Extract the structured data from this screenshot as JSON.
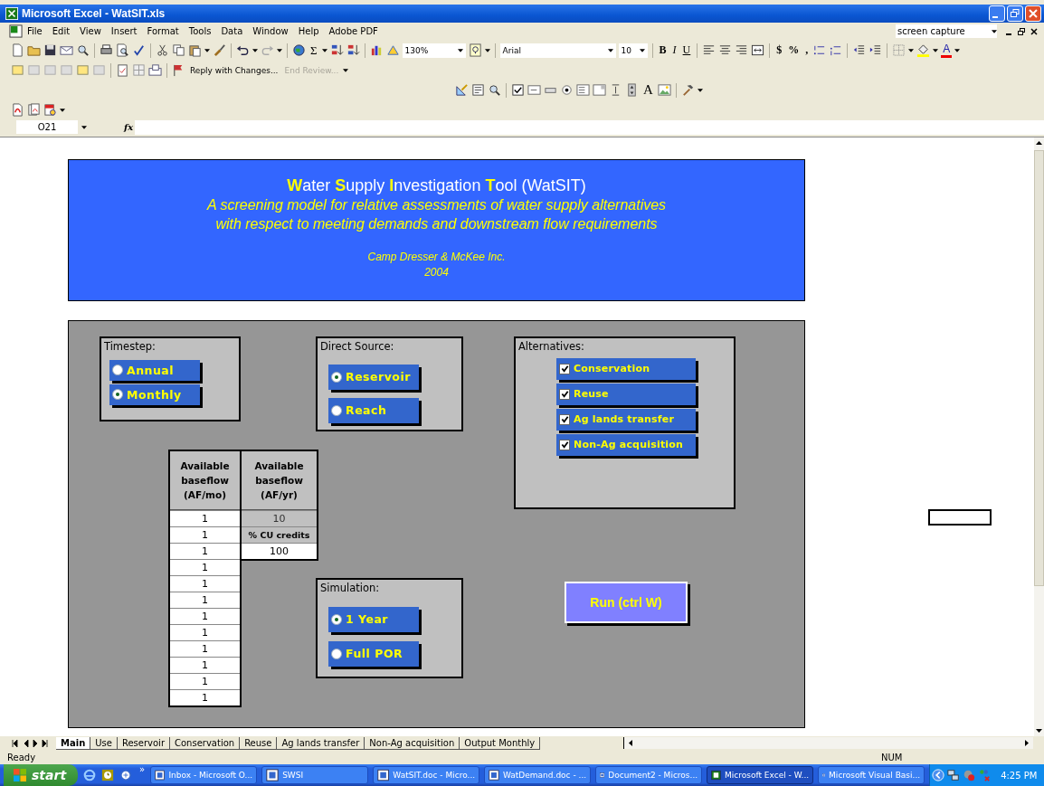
{
  "window": {
    "title": "Microsoft Excel - WatSIT.xls"
  },
  "menu": [
    "File",
    "Edit",
    "View",
    "Insert",
    "Format",
    "Tools",
    "Data",
    "Window",
    "Help",
    "Adobe PDF"
  ],
  "help_box": {
    "value": "screen capture"
  },
  "toolbar": {
    "sum": "Σ",
    "zoom": "130%",
    "font": "Arial",
    "font_size": "10",
    "format_buttons": [
      "B",
      "I",
      "U"
    ],
    "number_buttons": [
      "$",
      "%",
      ","
    ],
    "font_color": "A"
  },
  "review_toolbar": {
    "reply": "Reply with Changes...",
    "end_review": "End Review...",
    "end_review_disabled": true
  },
  "forms_toolbar": {
    "label_tool": "A"
  },
  "formula_bar": {
    "name_box": "O21",
    "fx": "fx"
  },
  "banner": {
    "title": "**W**ater **S**upply **I**nvestigation **T**ool (WatSIT)",
    "subtitle": [
      "A screening model for relative assessments of water supply alternatives",
      "with respect to meeting demands and downstream flow requirements"
    ],
    "author": "Camp Dresser & McKee Inc.",
    "year": "2004"
  },
  "timestep": {
    "label": "Timestep:",
    "options": [
      {
        "label": "Annual",
        "selected": false
      },
      {
        "label": "Monthly",
        "selected": true
      }
    ]
  },
  "direct_source": {
    "label": "Direct Source:",
    "options": [
      {
        "label": "Reservoir",
        "selected": true
      },
      {
        "label": "Reach",
        "selected": false
      }
    ]
  },
  "alternatives": {
    "label": "Alternatives:",
    "items": [
      {
        "label": "Conservation",
        "checked": true
      },
      {
        "label": "Reuse",
        "checked": true
      },
      {
        "label": "Ag lands transfer",
        "checked": true
      },
      {
        "label": "Non-Ag acquisition",
        "checked": true
      }
    ]
  },
  "baseflow_table": {
    "columns": [
      "Available baseflow (AF/mo)",
      "Available baseflow (AF/yr)"
    ],
    "monthly": [
      "1",
      "1",
      "1",
      "1",
      "1",
      "1",
      "1",
      "1",
      "1",
      "1",
      "1",
      "1"
    ],
    "annual": [
      {
        "kind": "shaded",
        "text": "10"
      },
      {
        "kind": "label",
        "text": "% CU credits"
      },
      {
        "kind": "value",
        "text": "100"
      }
    ]
  },
  "simulation": {
    "label": "Simulation:",
    "options": [
      {
        "label": "1 Year",
        "selected": true
      },
      {
        "label": "Full POR",
        "selected": false
      }
    ]
  },
  "run_button": "Run (ctrl W)",
  "sheet_tabs": [
    {
      "label": "Main",
      "selected": true
    },
    {
      "label": "Use",
      "selected": false
    },
    {
      "label": "Reservoir",
      "selected": false
    },
    {
      "label": "Conservation",
      "selected": false
    },
    {
      "label": "Reuse",
      "selected": false
    },
    {
      "label": "Ag lands transfer",
      "selected": false
    },
    {
      "label": "Non-Ag acquisition",
      "selected": false
    },
    {
      "label": "Output Monthly",
      "selected": false
    }
  ],
  "status_bar": {
    "status": "Ready",
    "num_lock": "NUM"
  },
  "taskbar": {
    "start": "start",
    "more": "»",
    "tasks": [
      {
        "label": "Inbox - Microsoft O...",
        "selected": false
      },
      {
        "label": "SWSI",
        "selected": false
      },
      {
        "label": "WatSIT.doc - Micro...",
        "selected": false
      },
      {
        "label": "WatDemand.doc - ...",
        "selected": false
      },
      {
        "label": "Document2 - Micros...",
        "selected": false
      },
      {
        "label": "Microsoft Excel - W...",
        "selected": true
      },
      {
        "label": "Microsoft Visual Basi...",
        "selected": false
      }
    ],
    "clock": "4:25 PM"
  }
}
